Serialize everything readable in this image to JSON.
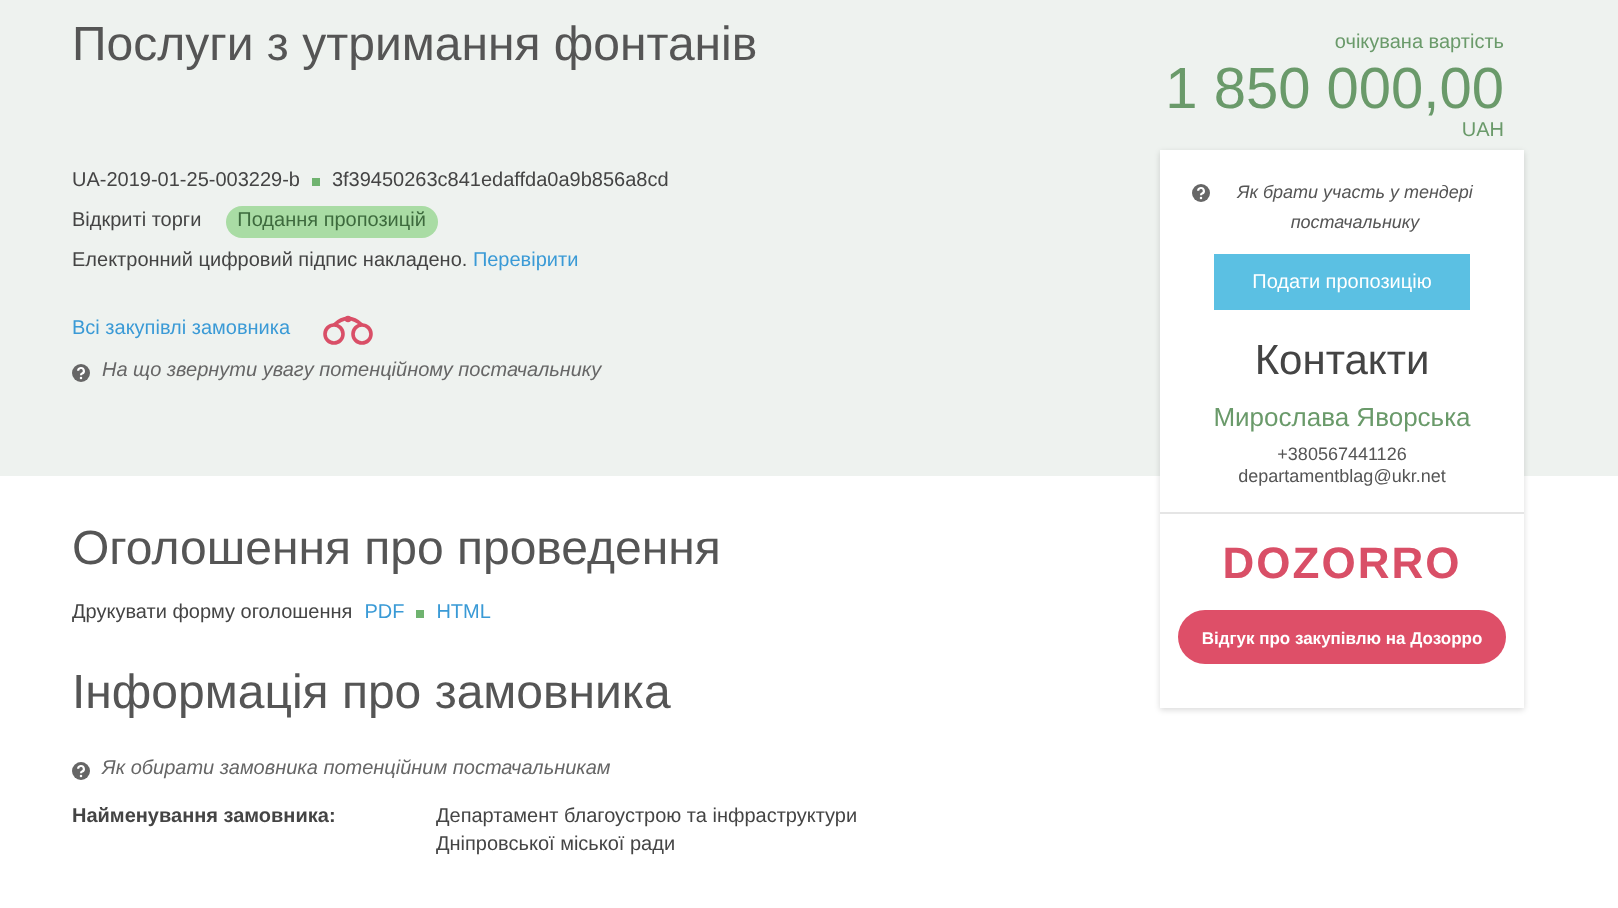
{
  "title": "Послуги з утримання фонтанів",
  "tender_id": "UA-2019-01-25-003229-b",
  "hash": "3f39450263c841edaffda0a9b856a8cd",
  "procedure": "Відкриті торги",
  "status": "Подання пропозицій",
  "signature": {
    "text": "Електронний цифровий підпис накладено.",
    "link": "Перевірити"
  },
  "buyer_link": "Всі закупівлі замовника",
  "hint": "На що звернути увагу потенційному постачальнику",
  "price": {
    "caption": "очікувана вартість",
    "amount": "1 850 000,00",
    "currency": "UAH"
  },
  "sidebar": {
    "hint": "Як брати участь у тендері постачальнику",
    "button": "Подати пропозицію",
    "contacts_title": "Контакти",
    "contact_name": "Мирослава Яворська",
    "phone": "+380567441126",
    "email": "departamentblag@ukr.net",
    "logo": "DOZORRO",
    "feedback_button": "Відгук про закупівлю на Дозорро"
  },
  "announcement": {
    "title": "Оголошення про проведення",
    "print_label": "Друкувати форму оголошення",
    "formats": [
      "PDF",
      "HTML"
    ]
  },
  "buyer": {
    "title": "Інформація про замовника",
    "hint": "Як обирати замовника потенційним постачальникам",
    "fields": [
      {
        "label": "Найменування замовника:",
        "value": "Департамент благоустрою та інфраструктури Дніпровської міської ради"
      }
    ]
  }
}
